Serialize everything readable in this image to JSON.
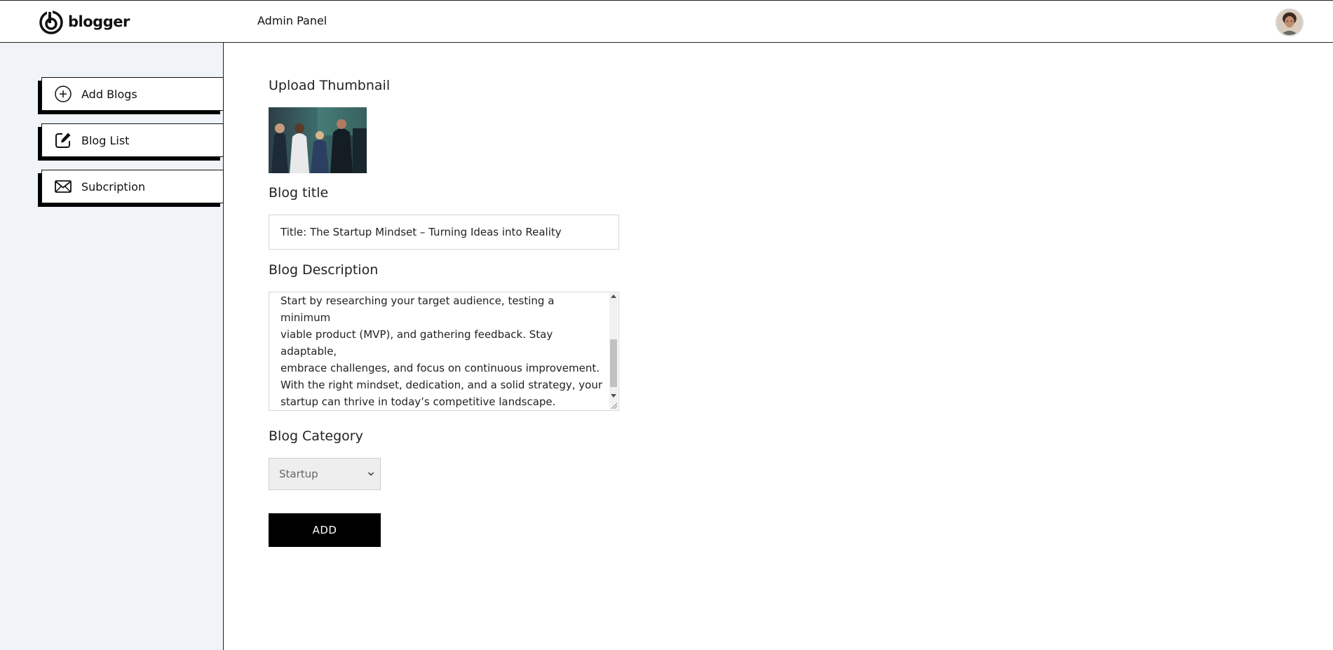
{
  "brand": {
    "name": "blogger"
  },
  "sidebar": {
    "items": [
      {
        "label": "Add Blogs",
        "icon": "plus-circle-icon"
      },
      {
        "label": "Blog List",
        "icon": "edit-square-icon"
      },
      {
        "label": "Subcription",
        "icon": "envelope-icon"
      }
    ]
  },
  "header": {
    "title": "Admin Panel",
    "avatar_icon": "user-avatar"
  },
  "form": {
    "thumbnail_label": "Upload Thumbnail",
    "title_label": "Blog title",
    "title_value": "Title: The Startup Mindset – Turning Ideas into Reality",
    "description_label": "Blog Description",
    "description_value": "Start by researching your target audience, testing a minimum\nviable product (MVP), and gathering feedback. Stay adaptable,\nembrace challenges, and focus on continuous improvement.\nWith the right mindset, dedication, and a solid strategy, your\nstartup can thrive in today’s competitive landscape.\n\nLet me know if you need a more refined version!",
    "category_label": "Blog Category",
    "category_selected": "Startup",
    "submit_label": "ADD"
  },
  "colors": {
    "sidebar_bg": "#f0f4f9",
    "button_bg": "#000000",
    "button_text": "#ffffff"
  }
}
